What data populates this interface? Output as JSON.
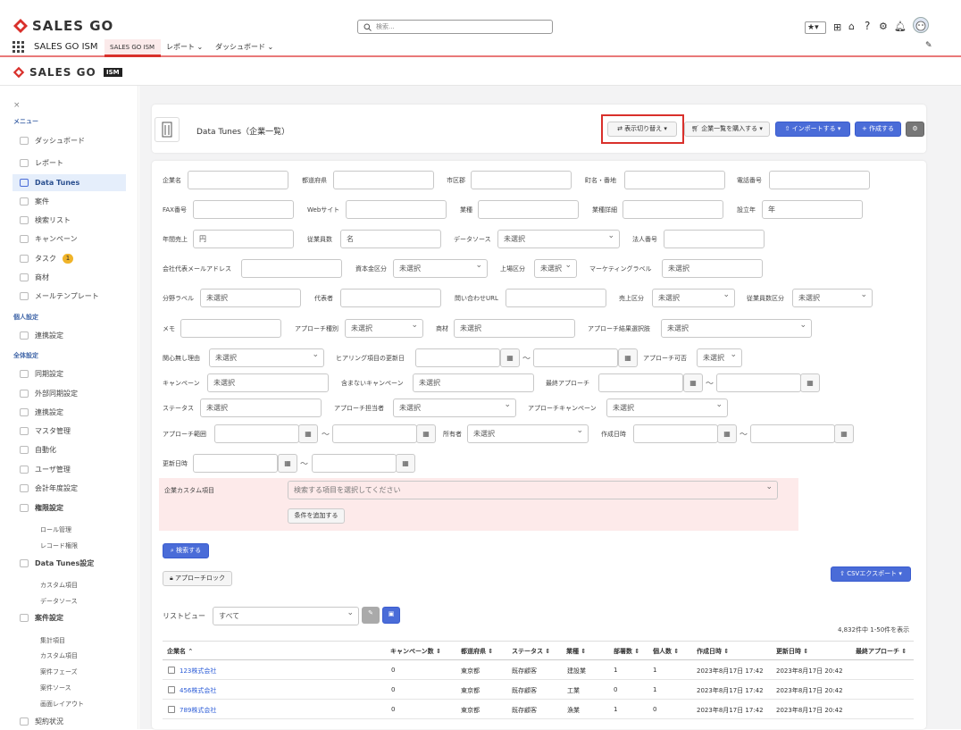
{
  "header": {
    "logo_text": "SALES GO",
    "search_placeholder": "検索...",
    "app_name": "SALES GO ISM",
    "tabs": [
      {
        "label": "SALES GO ISM"
      },
      {
        "label": "レポート"
      },
      {
        "label": "ダッシュボード"
      }
    ],
    "brand_logo_text": "SALES GO",
    "brand_logo_badge": "ISM"
  },
  "sidebar": {
    "close": "×",
    "sections": {
      "menu": "メニュー",
      "personal": "個人設定",
      "all": "全体設定"
    },
    "items": [
      {
        "label": "ダッシュボード"
      },
      {
        "label": "レポート"
      },
      {
        "label": "Data Tunes"
      },
      {
        "label": "案件"
      },
      {
        "label": "検索リスト"
      },
      {
        "label": "キャンペーン"
      },
      {
        "label": "タスク"
      },
      {
        "label": "商材"
      },
      {
        "label": "メールテンプレート"
      },
      {
        "label": "連携設定"
      },
      {
        "label": "同期設定"
      },
      {
        "label": "外部同期設定"
      },
      {
        "label": "連携設定"
      },
      {
        "label": "マスタ管理"
      },
      {
        "label": "自動化"
      },
      {
        "label": "ユーザ管理"
      },
      {
        "label": "会計年度設定"
      },
      {
        "label": "権限設定"
      },
      {
        "label": "ロール管理"
      },
      {
        "label": "レコード権限"
      },
      {
        "label": "Data Tunes設定"
      },
      {
        "label": "カスタム項目"
      },
      {
        "label": "データソース"
      },
      {
        "label": "案件設定"
      },
      {
        "label": "集計項目"
      },
      {
        "label": "カスタム項目"
      },
      {
        "label": "案件フェーズ"
      },
      {
        "label": "案件ソース"
      },
      {
        "label": "画面レイアウト"
      },
      {
        "label": "契約状況"
      }
    ],
    "task_badge": "1"
  },
  "page": {
    "title": "Data Tunes（企業一覧）",
    "buttons": {
      "toggle_view": "表示切り替え",
      "buy_list": "企業一覧を購入する",
      "import": "インポートする",
      "create": "作成する"
    }
  },
  "filters": {
    "company_name": "企業名",
    "prefecture": "都道府県",
    "city": "市区郡",
    "town": "町名・番地",
    "phone": "電話番号",
    "fax": "FAX番号",
    "website": "Webサイト",
    "industry": "業種",
    "industry_detail": "業種詳細",
    "founded": "設立年",
    "founded_unit": "年",
    "revenue": "年間売上",
    "revenue_unit": "円",
    "employees": "従業員数",
    "employees_unit": "名",
    "datasource": "データソース",
    "unselected": "未選択",
    "corp_number": "法人番号",
    "rep_email": "会社代表メールアドレス",
    "capital": "資本金区分",
    "listed": "上場区分",
    "marketing_label": "マーケティングラベル",
    "category_label": "分野ラベル",
    "representative": "代表者",
    "contact_url": "問い合わせURL",
    "sales_class": "売上区分",
    "employee_class": "従業員数区分",
    "memo": "メモ",
    "approach_flag": "アプローチ種別",
    "product": "商材",
    "approach_result": "アプローチ結果選択肢",
    "no_interest": "関心無し理由",
    "hearing_updated": "ヒアリング項目の更新日",
    "approach_ok": "アプローチ可否",
    "campaign": "キャンペーン",
    "excluded_campaign": "含まないキャンペーン",
    "last_approach": "最終アプローチ",
    "status": "ステータス",
    "approach_owner": "アプローチ担当者",
    "approach_campaign": "アプローチキャンペーン",
    "approach_range": "アプローチ範囲",
    "owner": "所有者",
    "created": "作成日時",
    "updated": "更新日時",
    "custom_field": "企業カスタム項目",
    "custom_placeholder": "検索する項目を選択してください",
    "add_condition": "条件を追加する",
    "search_btn": "検索する",
    "tilde": "〜"
  },
  "list": {
    "approach_lock": "アプローチロック",
    "csv_export": "CSVエクスポート",
    "list_view_label": "リストビュー",
    "list_view_value": "すべて",
    "count": "4,832件中 1-50件を表示",
    "columns": [
      "企業名 ⌃",
      "キャンペーン数 ⇕",
      "都道府県 ⇕",
      "ステータス ⇕",
      "業種 ⇕",
      "部署数 ⇕",
      "個人数 ⇕",
      "作成日時 ⇕",
      "更新日時 ⇕",
      "最終アプローチ ⇕"
    ],
    "rows": [
      {
        "name": "123株式会社",
        "campaigns": "0",
        "pref": "東京都",
        "status": "既存顧客",
        "industry": "建設業",
        "depts": "1",
        "people": "1",
        "created": "2023年8月17日 17:42",
        "updated": "2023年8月17日 20:42",
        "last": ""
      },
      {
        "name": "456株式会社",
        "campaigns": "0",
        "pref": "東京都",
        "status": "既存顧客",
        "industry": "工業",
        "depts": "0",
        "people": "1",
        "created": "2023年8月17日 17:42",
        "updated": "2023年8月17日 20:42",
        "last": ""
      },
      {
        "name": "789株式会社",
        "campaigns": "0",
        "pref": "東京都",
        "status": "既存顧客",
        "industry": "漁業",
        "depts": "1",
        "people": "0",
        "created": "2023年8月17日 17:42",
        "updated": "2023年8月17日 20:42",
        "last": ""
      }
    ]
  },
  "colors": {
    "accent_red": "#d9302b",
    "blue": "#4a6cd8",
    "link": "#2a5bd7"
  }
}
